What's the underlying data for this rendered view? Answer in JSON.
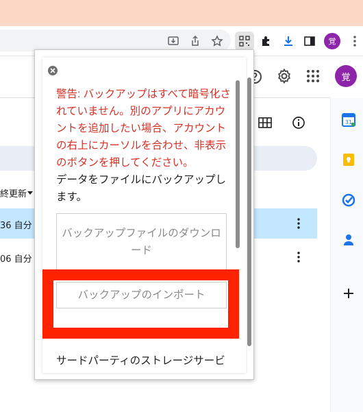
{
  "browser": {
    "avatar_letter": "覚",
    "icons": [
      "install-app-icon",
      "share-icon",
      "bookmark-star-icon",
      "qr-extension-icon",
      "extensions-puzzle-icon",
      "downloads-icon",
      "side-panel-icon"
    ]
  },
  "drive": {
    "avatar_letter": "覚",
    "sort_label": "終更新",
    "rows": [
      {
        "cell": "36 自分",
        "selected": true
      },
      {
        "cell": "06 自分",
        "selected": false
      }
    ],
    "side_apps": [
      "calendar-icon",
      "keep-icon",
      "tasks-icon",
      "contacts-icon",
      "add-icon"
    ]
  },
  "popup": {
    "warning": "警告: バックアップはすべて暗号化されていません。別のアプリにアカウントを追加したい場合、アカウントの右上にカーソルを合わせ、非表示のボタンを押してください。",
    "description": "データをファイルにバックアップします。",
    "download_button": "バックアップファイルのダウンロード",
    "import_button": "バックアップのインポート",
    "third_party": "サードパーティのストレージサービ"
  },
  "colors": {
    "warning": "#d93025",
    "highlight": "#ff2200",
    "selected_row": "#c2e7ff",
    "titlebar": "#fbd8c6",
    "avatar": "#8e24aa"
  }
}
